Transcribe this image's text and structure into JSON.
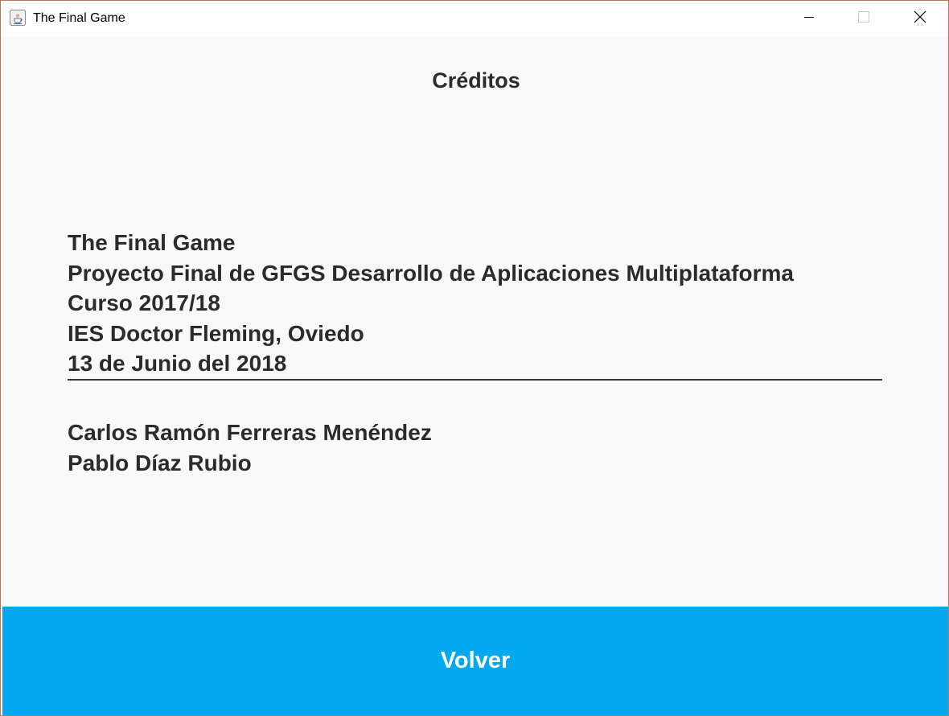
{
  "window": {
    "title": "The Final Game",
    "app_icon": "java-cup-icon",
    "controls": [
      "minimize-icon",
      "maximize-icon",
      "close-icon"
    ]
  },
  "page": {
    "heading": "Créditos",
    "info_lines": [
      "The Final Game",
      "Proyecto Final de GFGS Desarrollo de Aplicaciones Multiplataforma",
      "Curso 2017/18",
      "IES Doctor Fleming, Oviedo",
      "13 de Junio del 2018"
    ],
    "authors": [
      "Carlos Ramón Ferreras Menéndez",
      "Pablo Díaz Rubio"
    ]
  },
  "footer": {
    "back_label": "Volver"
  },
  "colors": {
    "background": "#f8f8f8",
    "text": "#2b2b2b",
    "button": "#03a9f0",
    "button_text": "#ffffff",
    "window_border": "#b4785a"
  }
}
